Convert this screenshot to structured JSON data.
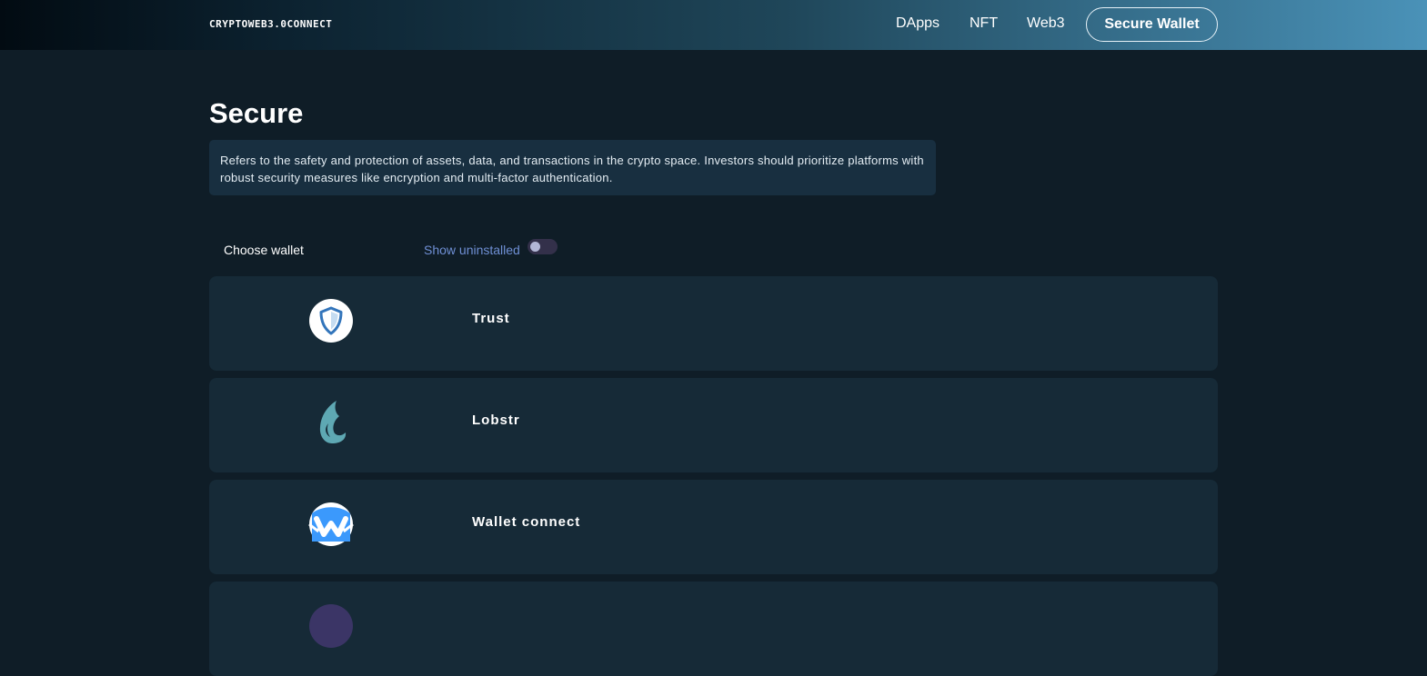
{
  "header": {
    "brand": "CRYPTOWEB3.0CONNECT",
    "nav": {
      "dapps": "DApps",
      "nft": "NFT",
      "web3": "Web3",
      "cta": "Secure Wallet"
    }
  },
  "main": {
    "title": "Secure",
    "description": "Refers to the safety and protection of assets, data, and transactions in the crypto space. Investors should prioritize platforms with robust security measures like encryption and multi-factor authentication.",
    "choose_label": "Choose wallet",
    "show_uninstalled_label": "Show uninstalled",
    "show_uninstalled_on": false
  },
  "wallets": [
    {
      "name": "Trust",
      "icon": "trust-shield-icon",
      "color": "#3375bb"
    },
    {
      "name": "Lobstr",
      "icon": "lobstr-leaf-icon",
      "color": "#5ea8b3"
    },
    {
      "name": "Wallet connect",
      "icon": "walletconnect-icon",
      "color": "#3b99fc"
    },
    {
      "name": "",
      "icon": "wallet-icon",
      "color": "#3b3566"
    }
  ],
  "colors": {
    "background": "#0f1d27",
    "card": "#162a37",
    "description_box": "#182f40",
    "link_accent": "#6f8fd4"
  }
}
